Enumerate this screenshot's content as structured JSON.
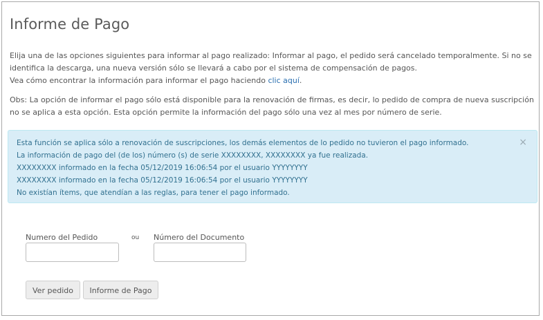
{
  "page": {
    "title": "Informe de Pago"
  },
  "intro": {
    "text": "Elija una de las opciones siguientes para informar al pago realizado: Informar al pago, el pedido será cancelado temporalmente. Si no se identifica la descarga, una nueva versión sólo se llevará a cabo por el sistema de compensación de pagos.",
    "howto_text": "Vea cómo encontrar la información para informar el pago haciendo ",
    "link_label": "clic aquí",
    "link_suffix": "."
  },
  "note": {
    "text": "Obs: La opción de informar el pago sólo está disponible para la renovación de firmas, es decir, lo pedido de compra de nueva suscripción no se aplica a esta opción. Esta opción permite la información del pago sólo una vez al mes por número de serie."
  },
  "alert": {
    "close_symbol": "×",
    "lines": [
      "Esta función se aplica sólo a  renovación de suscripciones, los demás elementos de lo pedido no tuvieron el pago informado.",
      "La información de pago del (de los) número (s) de serie XXXXXXXX, XXXXXXXX ya fue realizada.",
      "XXXXXXXX informado en la fecha 05/12/2019 16:06:54 por el usuario YYYYYYYY",
      "XXXXXXXX informado en la fecha 05/12/2019 16:06:54 por el usuario YYYYYYYY",
      "No existían ítems, que atendían a las reglas, para tener el pago informado."
    ]
  },
  "form": {
    "pedido_label": "Numero del Pedido",
    "pedido_value": "",
    "or_label": "ou",
    "documento_label": "Número del Documento",
    "documento_value": ""
  },
  "buttons": {
    "ver_pedido": "Ver pedido",
    "informe_pago": "Informe de Pago"
  },
  "colors": {
    "alert_bg": "#d9edf7",
    "alert_text": "#31708f",
    "link": "#2a6fb0"
  }
}
